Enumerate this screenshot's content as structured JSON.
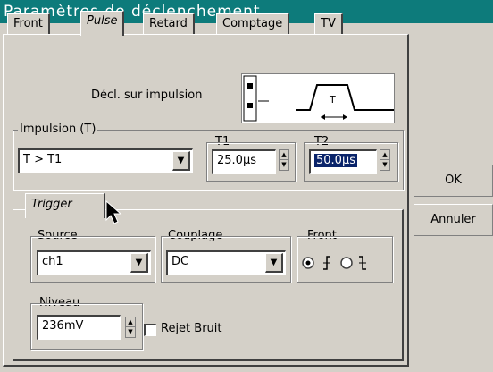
{
  "window": {
    "title": "Paramètres de déclenchement"
  },
  "tabs": [
    {
      "label": "Front",
      "active": false
    },
    {
      "label": "Pulse",
      "active": true
    },
    {
      "label": "Retard",
      "active": false
    },
    {
      "label": "Comptage",
      "active": false
    },
    {
      "label": "TV",
      "active": false
    }
  ],
  "pulse": {
    "decl_label": "Décl. sur impulsion",
    "diagram_label": "T",
    "impulsion": {
      "legend": "Impulsion (T)",
      "condition": "T > T1",
      "t1_label": "T1",
      "t1_value": "25.0µs",
      "t2_label": "T2",
      "t2_value": "50.0µs"
    }
  },
  "trigger": {
    "tab_label": "Trigger",
    "source_legend": "Source",
    "source_value": "ch1",
    "couplage_legend": "Couplage",
    "couplage_value": "DC",
    "front_legend": "Front",
    "front_rising_selected": true,
    "niveau_legend": "Niveau",
    "niveau_value": "236mV",
    "rejet_bruit_label": "Rejet Bruit",
    "rejet_bruit_checked": false
  },
  "actions": {
    "ok_label": "OK",
    "cancel_label": "Annuler"
  },
  "colors": {
    "titlebar": "#0d7b7b",
    "face": "#d4d0c8",
    "selection": "#0a246a"
  }
}
